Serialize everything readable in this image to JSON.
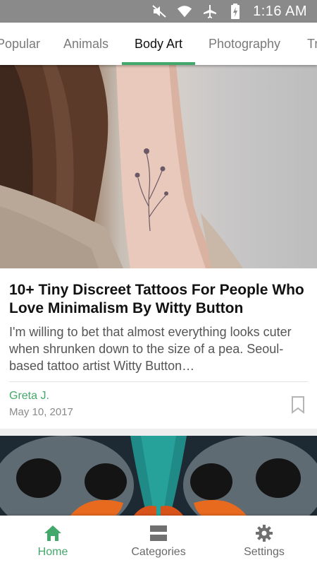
{
  "status_bar": {
    "time": "1:16 AM",
    "icons": [
      "mute-icon",
      "wifi-icon",
      "airplane-mode-icon",
      "battery-charging-icon"
    ]
  },
  "tabs": [
    {
      "label": "Popular",
      "active": false
    },
    {
      "label": "Animals",
      "active": false
    },
    {
      "label": "Body Art",
      "active": true
    },
    {
      "label": "Photography",
      "active": false
    },
    {
      "label": "Tr",
      "active": false
    }
  ],
  "articles": [
    {
      "title": "10+ Tiny Discreet Tattoos For People Who Love Minimalism By Witty Button",
      "excerpt": "I'm willing to bet that almost everything looks cuter when shrunken down to the size of a pea. Seoul-based tattoo artist Witty Button…",
      "author": "Greta J.",
      "date": "May 10, 2017",
      "bookmark_icon": "bookmark-outline-icon"
    }
  ],
  "bottom_nav": [
    {
      "label": "Home",
      "icon": "home-icon",
      "active": true
    },
    {
      "label": "Categories",
      "icon": "categories-icon",
      "active": false
    },
    {
      "label": "Settings",
      "icon": "gear-icon",
      "active": false
    }
  ],
  "colors": {
    "accent": "#43a86b",
    "status_bar": "#8a8a8a",
    "title": "#111111",
    "body_text": "#555555",
    "inactive": "#7a7a7a"
  }
}
